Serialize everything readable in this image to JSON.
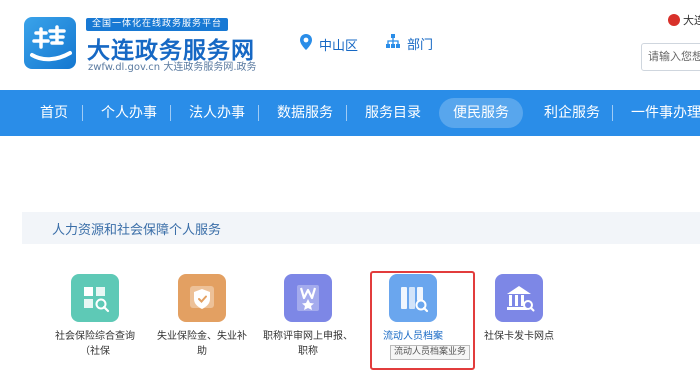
{
  "header": {
    "tagline": "全国一体化在线政务服务平台",
    "site_name": "大连政务服务网",
    "site_url": "zwfw.dl.gov.cn  大连政务服务网.政务",
    "region": "中山区",
    "department": "部门",
    "top_right_text": "大连",
    "search_placeholder": "请输入您想"
  },
  "nav": {
    "items": [
      {
        "label": "首页"
      },
      {
        "label": "个人办事"
      },
      {
        "label": "法人办事"
      },
      {
        "label": "数据服务"
      },
      {
        "label": "服务目录"
      },
      {
        "label": "便民服务"
      },
      {
        "label": "利企服务"
      },
      {
        "label": "一件事办理"
      }
    ],
    "active_index": 5
  },
  "section": {
    "title": "人力资源和社会保障个人服务"
  },
  "tiles": [
    {
      "label": "社会保险综合查询（社保",
      "icon": "grid-search-icon",
      "color": "#5ec9b6"
    },
    {
      "label": "失业保险金、失业补助",
      "icon": "shield-icon",
      "color": "#e3a062"
    },
    {
      "label": "职称评审网上申报、职称",
      "icon": "star-award-icon",
      "color": "#7d87e6"
    },
    {
      "label": "流动人员档案",
      "icon": "archive-search-icon",
      "color": "#6aa6ee"
    },
    {
      "label": "社保卡发卡网点",
      "icon": "bank-search-icon",
      "color": "#7d87e6"
    }
  ],
  "tooltip": "流动人员档案业务",
  "colors": {
    "nav_bg": "#2a8de8",
    "brand": "#1668c4",
    "highlight": "#e23c3c"
  }
}
